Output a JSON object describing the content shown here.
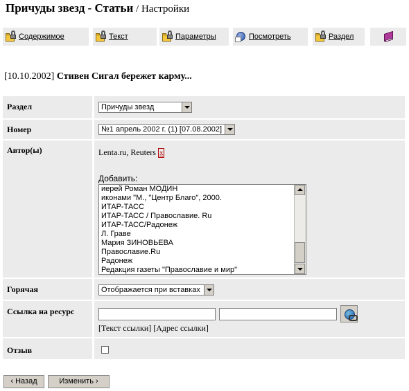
{
  "header": {
    "crumb": "Причуды звезд - Статьи",
    "separator": " / ",
    "page": "Настройки"
  },
  "toolbar": {
    "items": [
      {
        "label": "Содержимое",
        "icon": "folder-lock-icon"
      },
      {
        "label": "Текст",
        "icon": "folder-lock-icon"
      },
      {
        "label": "Параметры",
        "icon": "folder-lock-icon"
      },
      {
        "label": "Посмотреть",
        "icon": "globe-page-icon"
      },
      {
        "label": "Раздел",
        "icon": "folder-lock-icon"
      },
      {
        "label": "",
        "icon": "book-icon"
      }
    ]
  },
  "article": {
    "date": "[10.10.2002]",
    "title": "Стивен Сигал бережет карму..."
  },
  "form": {
    "section": {
      "label": "Раздел",
      "value": "Причуды звезд"
    },
    "issue": {
      "label": "Номер",
      "value": "№1 апрель 2002 г. (1) [07.08.2002]"
    },
    "authors": {
      "label": "Автор(ы)",
      "current": "Lenta.ru, Reuters",
      "remove": "x",
      "add_label": "Добавить:",
      "options": [
        "иерей Роман МОДИН",
        "иконами \"М., \"Центр Благо\", 2000.",
        "ИТАР-ТАСС",
        "ИТАР-ТАСС / Православие. Ru",
        "ИТАР-ТАСС/Радонеж",
        "Л. Граве",
        "Мария ЗИНОВЬЕВА",
        "Православие.Ru",
        "Радонеж",
        "Редакция газеты \"Православие и мир\""
      ]
    },
    "hot": {
      "label": "Горячая",
      "value": "Отображается при вставках"
    },
    "link": {
      "label": "Ссылка на ресурс",
      "text_value": "",
      "url_value": "",
      "hint": "[Текст ссылки] [Адрес ссылки]"
    },
    "feedback": {
      "label": "Отзыв",
      "checked": false
    }
  },
  "buttons": {
    "back": "‹ Назад",
    "change": "Изменить ›"
  }
}
